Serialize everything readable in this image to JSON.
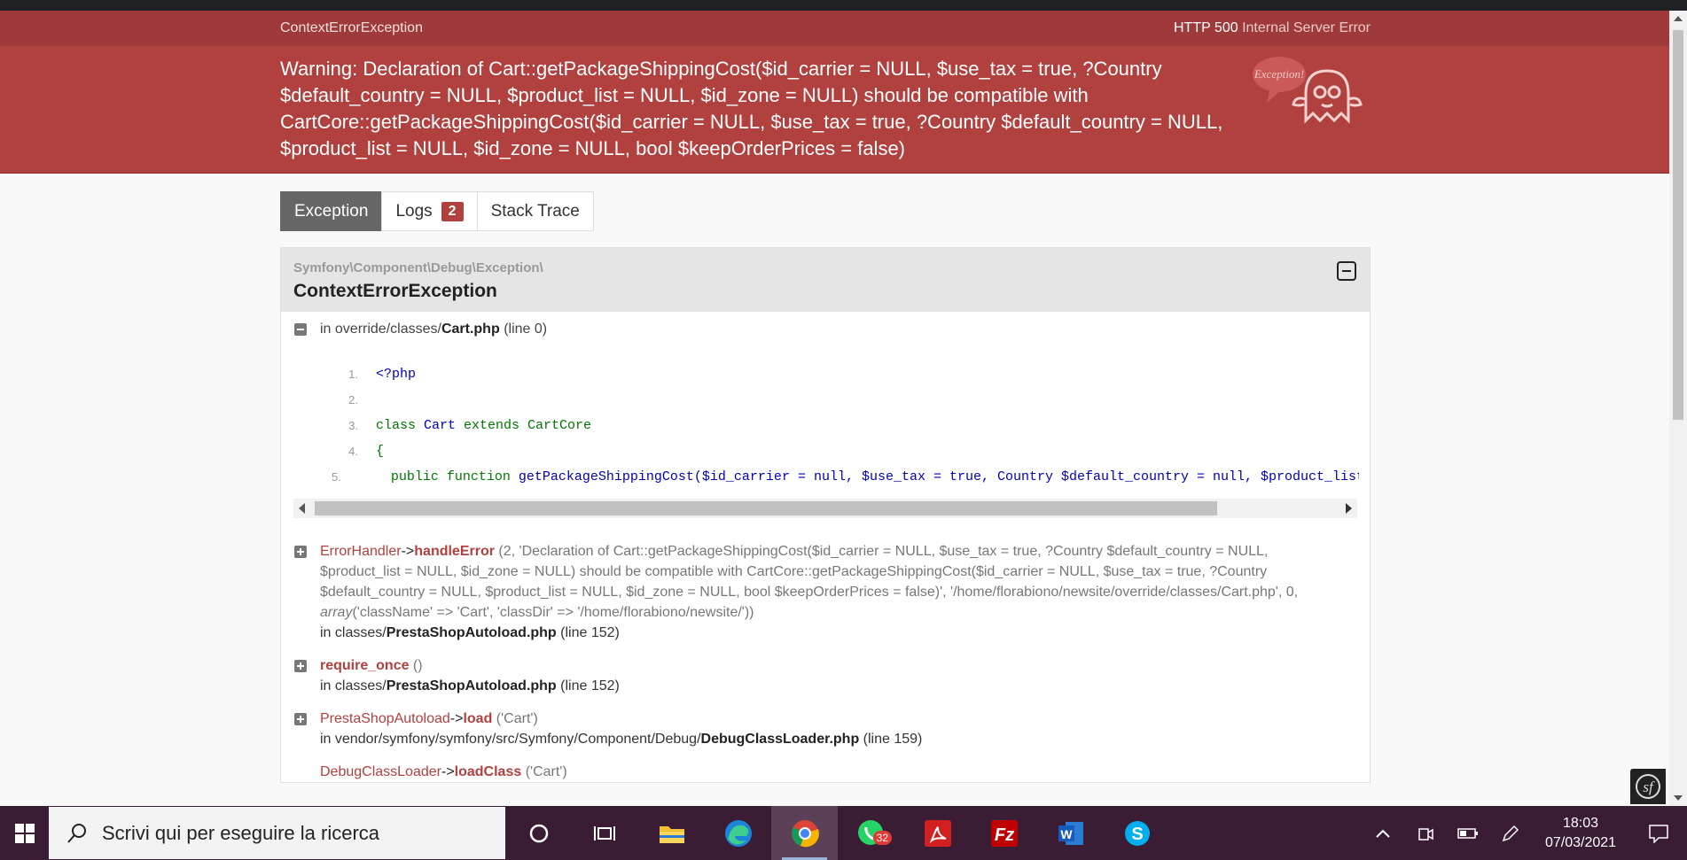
{
  "page": {
    "header": {
      "exception_class": "ContextErrorException",
      "http_code": "HTTP 500",
      "http_text": "Internal Server Error"
    },
    "message": "Warning: Declaration of Cart::getPackageShippingCost($id_carrier = NULL, $use_tax = true, ?Country $default_country = NULL, $product_list = NULL, $id_zone = NULL) should be compatible with CartCore::getPackageShippingCost($id_carrier = NULL, $use_tax = true, ?Country $default_country = NULL, $product_list = NULL, $id_zone = NULL, bool $keepOrderPrices = false)",
    "ghost_badge": "Exception!",
    "tabs": [
      {
        "label": "Exception"
      },
      {
        "label": "Logs",
        "badge": "2"
      },
      {
        "label": "Stack Trace"
      }
    ],
    "panel": {
      "namespace": "Symfony\\Component\\Debug\\Exception\\",
      "class": "ContextErrorException"
    },
    "trace0": {
      "prefix": "in override/classes/",
      "file": "Cart.php",
      "line": "(line 0)"
    },
    "code": {
      "lines": [
        {
          "n": "1.",
          "a": "<?php",
          "b": "",
          "c": ""
        },
        {
          "n": "2.",
          "a": "",
          "b": "",
          "c": ""
        },
        {
          "n": "3.",
          "a": "class ",
          "b": "Cart",
          "c": " extends CartCore"
        },
        {
          "n": "4.",
          "a": "{",
          "b": "",
          "c": ""
        },
        {
          "n": "5.",
          "a": "    public function ",
          "b": "getPackageShippingCost",
          "c": "($id_carrier = null, $use_tax = true, Country $default_country = null, $product_list = nul"
        }
      ]
    },
    "traces": [
      {
        "cls": "ErrorHandler",
        "arrow": "->",
        "fn": "handleError",
        "args": " (2, 'Declaration of Cart::getPackageShippingCost($id_carrier = NULL, $use_tax = true, ?Country $default_country = NULL, $product_list = NULL, $id_zone = NULL) should be compatible with CartCore::getPackageShippingCost($id_carrier = NULL, $use_tax = true, ?Country $default_country = NULL, $product_list = NULL, $id_zone = NULL, bool $keepOrderPrices = false)', '/home/florabiono/newsite/override/classes/Cart.php', 0, ",
        "args_italic": "array",
        "args_tail": "('className' => 'Cart', 'classDir' => '/home/florabiono/newsite/'))",
        "loc_prefix": "in classes/",
        "loc_file": "PrestaShopAutoload.php",
        "loc_line": " (line 152)"
      },
      {
        "cls": "",
        "arrow": "",
        "fn": "require_once",
        "args": " ()",
        "args_italic": "",
        "args_tail": "",
        "loc_prefix": "in classes/",
        "loc_file": "PrestaShopAutoload.php",
        "loc_line": " (line 152)"
      },
      {
        "cls": "PrestaShopAutoload",
        "arrow": "->",
        "fn": "load",
        "args": " ('Cart')",
        "args_italic": "",
        "args_tail": "",
        "loc_prefix": "in vendor/symfony/symfony/src/Symfony/Component/Debug/",
        "loc_file": "DebugClassLoader.php",
        "loc_line": " (line 159)"
      },
      {
        "cls": "DebugClassLoader",
        "arrow": "->",
        "fn": "loadClass",
        "args": " ('Cart')",
        "args_italic": "",
        "args_tail": "",
        "loc_prefix": "",
        "loc_file": "",
        "loc_line": ""
      }
    ]
  },
  "taskbar": {
    "search_placeholder": "Scrivi qui per eseguire la ricerca",
    "whatsapp_badge": "32",
    "time": "18:03",
    "date": "07/03/2021"
  },
  "colors": {
    "header": "#9e3a3a",
    "message_bg": "#b0413e",
    "taskbar": "#3a1d35"
  }
}
